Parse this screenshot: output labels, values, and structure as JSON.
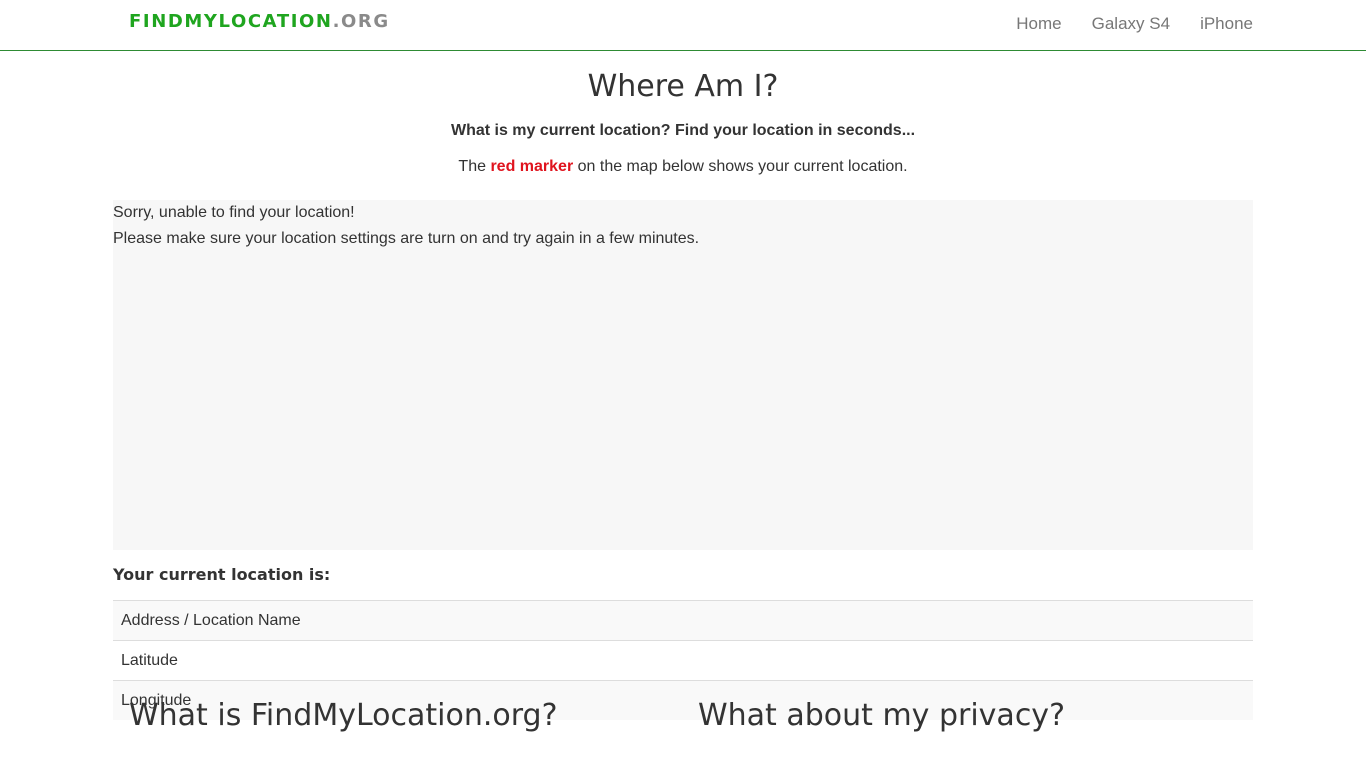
{
  "header": {
    "brand_main": "FINDMYLOCATION",
    "brand_suffix": ".ORG",
    "brand_color": "#1fa51f",
    "nav": [
      "Home",
      "Galaxy S4",
      "iPhone"
    ]
  },
  "main": {
    "title": "Where Am I?",
    "subtitle": "What is my current location? Find your location in seconds...",
    "marker_prefix": "The",
    "marker_highlight": "red marker",
    "marker_suffix": "on the map below shows your current location.",
    "marker_color": "#e0141e"
  },
  "map": {
    "error_line1": "Sorry, unable to find your location!",
    "error_line2": "Please make sure your location settings are turn on and try again in a few minutes."
  },
  "location": {
    "heading": "Your current location is:",
    "rows": [
      "Address / Location Name",
      "Latitude",
      "Longitude"
    ]
  },
  "faq": {
    "left_heading": "What is FindMyLocation.org?",
    "right_heading": "What about my privacy?"
  }
}
